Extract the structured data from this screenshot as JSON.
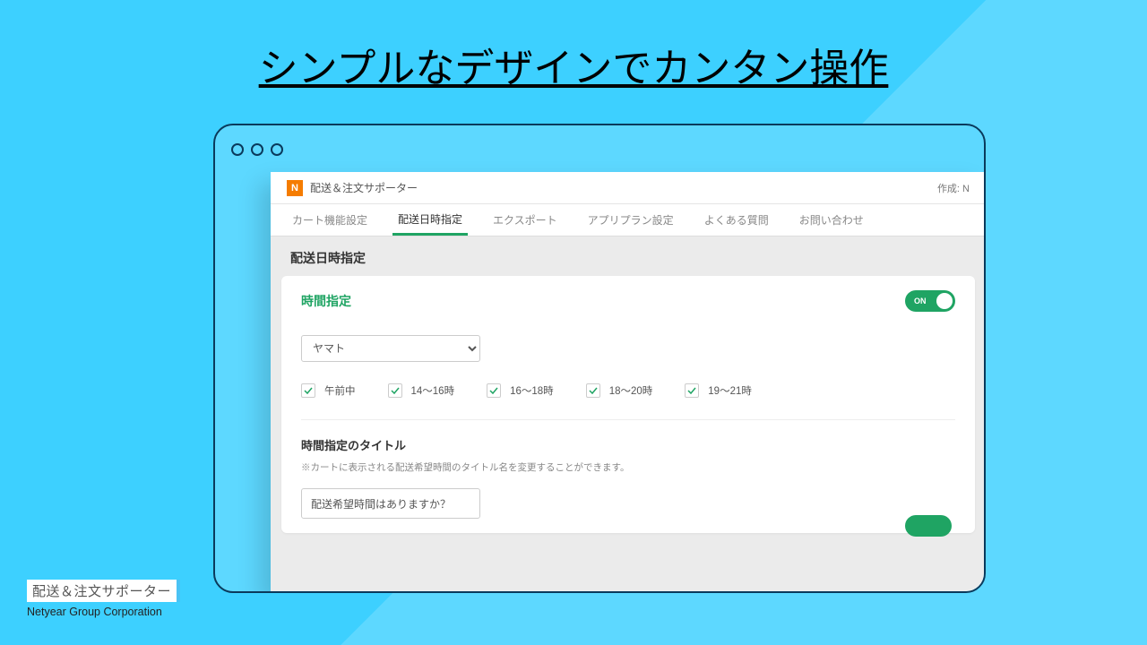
{
  "headline": "シンプルなデザインでカンタン操作",
  "browser": {
    "dots": 3
  },
  "app": {
    "logo_letter": "N",
    "title": "配送＆注文サポーター",
    "author_label": "作成: N"
  },
  "tabs": [
    {
      "label": "カート機能設定",
      "active": false
    },
    {
      "label": "配送日時指定",
      "active": true
    },
    {
      "label": "エクスポート",
      "active": false
    },
    {
      "label": "アプリプラン設定",
      "active": false
    },
    {
      "label": "よくある質問",
      "active": false
    },
    {
      "label": "お問い合わせ",
      "active": false
    }
  ],
  "page_title": "配送日時指定",
  "timeSection": {
    "title": "時間指定",
    "toggle": {
      "state": "ON"
    },
    "carrier_selected": "ヤマト",
    "slots": [
      {
        "label": "午前中",
        "checked": true
      },
      {
        "label": "14〜16時",
        "checked": true
      },
      {
        "label": "16〜18時",
        "checked": true
      },
      {
        "label": "18〜20時",
        "checked": true
      },
      {
        "label": "19〜21時",
        "checked": true
      }
    ],
    "subtitle": "時間指定のタイトル",
    "subdesc": "※カートに表示される配送希望時間のタイトル名を変更することができます。",
    "input_value": "配送希望時間はありますか？"
  },
  "footer": {
    "name": "配送＆注文サポーター",
    "corp": "Netyear Group Corporation"
  }
}
